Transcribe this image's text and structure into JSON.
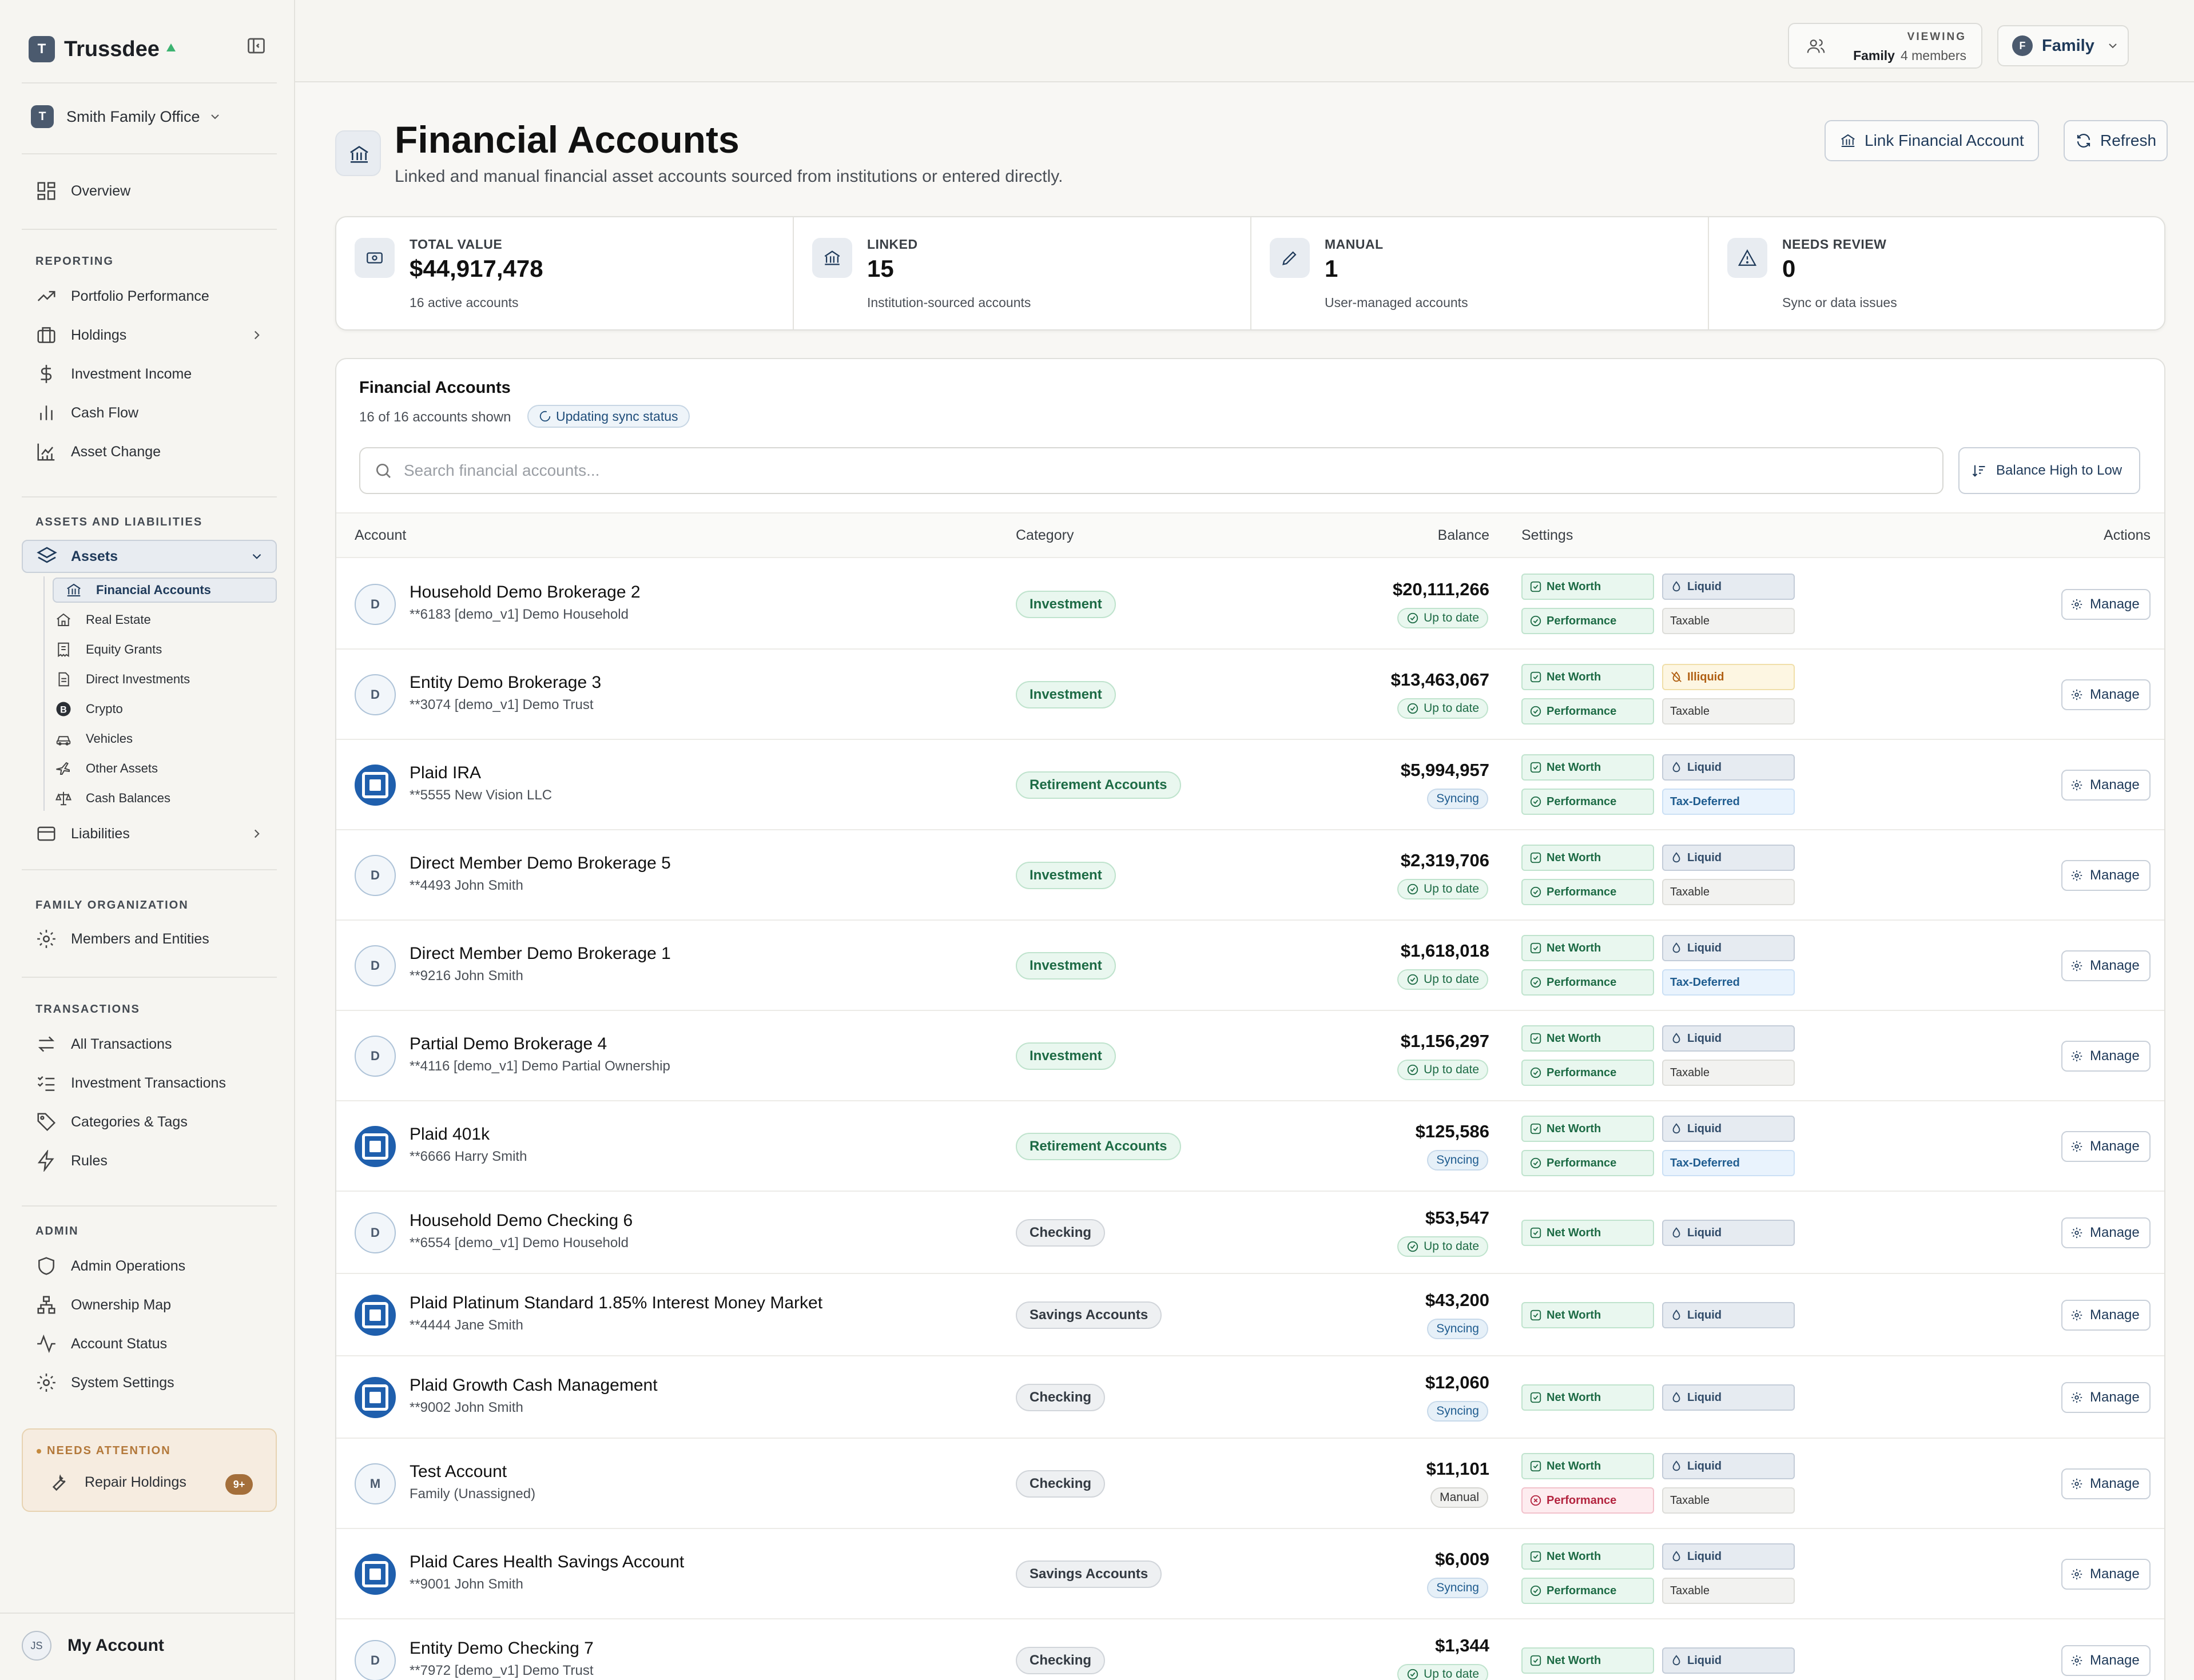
{
  "app": {
    "name": "Trussdee",
    "org": "Smith Family Office",
    "logo_letter": "T"
  },
  "sidebar": {
    "overview": "Overview",
    "reporting_header": "REPORTING",
    "reporting": [
      "Portfolio Performance",
      "Holdings",
      "Investment Income",
      "Cash Flow",
      "Asset Change"
    ],
    "assets_liab_header": "ASSETS AND LIABILITIES",
    "assets": "Assets",
    "asset_sub": [
      "Financial Accounts",
      "Real Estate",
      "Equity Grants",
      "Direct Investments",
      "Crypto",
      "Vehicles",
      "Other Assets",
      "Cash Balances"
    ],
    "liabilities": "Liabilities",
    "family_header": "FAMILY ORGANIZATION",
    "members": "Members and Entities",
    "transactions_header": "TRANSACTIONS",
    "transactions": [
      "All Transactions",
      "Investment Transactions",
      "Categories & Tags",
      "Rules"
    ],
    "admin_header": "ADMIN",
    "admin": [
      "Admin Operations",
      "Ownership Map",
      "Account Status",
      "System Settings"
    ],
    "attention_header": "NEEDS ATTENTION",
    "attention_item": "Repair Holdings",
    "attention_badge": "9+",
    "account_label": "My Account",
    "account_initials": "JS"
  },
  "topbar": {
    "viewing_label": "VIEWING",
    "viewing_name": "Family",
    "viewing_members": "4 members",
    "selector_letter": "F",
    "selector_label": "Family"
  },
  "page": {
    "title": "Financial Accounts",
    "subtitle": "Linked and manual financial asset accounts sourced from institutions or entered directly.",
    "link_button": "Link Financial Account",
    "refresh_button": "Refresh"
  },
  "stats": [
    {
      "label": "TOTAL VALUE",
      "value": "$44,917,478",
      "desc": "16 active accounts"
    },
    {
      "label": "LINKED",
      "value": "15",
      "desc": "Institution-sourced accounts"
    },
    {
      "label": "MANUAL",
      "value": "1",
      "desc": "User-managed accounts"
    },
    {
      "label": "NEEDS REVIEW",
      "value": "0",
      "desc": "Sync or data issues"
    }
  ],
  "table": {
    "title": "Financial Accounts",
    "count": "16 of 16 accounts shown",
    "sync_status": "Updating sync status",
    "search_placeholder": "Search financial accounts...",
    "sort_label": "Balance High to Low",
    "headers": {
      "account": "Account",
      "category": "Category",
      "balance": "Balance",
      "settings": "Settings",
      "actions": "Actions"
    },
    "manage_label": "Manage",
    "rows": [
      {
        "avatar": "D",
        "name": "Household Demo Brokerage 2",
        "sub": "**6183  [demo_v1] Demo Household",
        "category": "Investment",
        "balance": "$20,111,266",
        "status": "Up to date",
        "liquidity": "Liquid",
        "tax": "Taxable",
        "performance": "Performance"
      },
      {
        "avatar": "D",
        "name": "Entity Demo Brokerage 3",
        "sub": "**3074  [demo_v1] Demo Trust",
        "category": "Investment",
        "balance": "$13,463,067",
        "status": "Up to date",
        "liquidity": "Illiquid",
        "tax": "Taxable",
        "performance": "Performance"
      },
      {
        "avatar": "plaid",
        "name": "Plaid IRA",
        "sub": "**5555  New Vision LLC",
        "category": "Retirement Accounts",
        "balance": "$5,994,957",
        "status": "Syncing",
        "liquidity": "Liquid",
        "tax": "Tax-Deferred",
        "performance": "Performance"
      },
      {
        "avatar": "D",
        "name": "Direct Member Demo Brokerage 5",
        "sub": "**4493  John Smith",
        "category": "Investment",
        "balance": "$2,319,706",
        "status": "Up to date",
        "liquidity": "Liquid",
        "tax": "Taxable",
        "performance": "Performance"
      },
      {
        "avatar": "D",
        "name": "Direct Member Demo Brokerage 1",
        "sub": "**9216  John Smith",
        "category": "Investment",
        "balance": "$1,618,018",
        "status": "Up to date",
        "liquidity": "Liquid",
        "tax": "Tax-Deferred",
        "performance": "Performance"
      },
      {
        "avatar": "D",
        "name": "Partial Demo Brokerage 4",
        "sub": "**4116  [demo_v1] Demo Partial Ownership",
        "category": "Investment",
        "balance": "$1,156,297",
        "status": "Up to date",
        "liquidity": "Liquid",
        "tax": "Taxable",
        "performance": "Performance"
      },
      {
        "avatar": "plaid",
        "name": "Plaid 401k",
        "sub": "**6666  Harry Smith",
        "category": "Retirement Accounts",
        "balance": "$125,586",
        "status": "Syncing",
        "liquidity": "Liquid",
        "tax": "Tax-Deferred",
        "performance": "Performance"
      },
      {
        "avatar": "D",
        "name": "Household Demo Checking 6",
        "sub": "**6554  [demo_v1] Demo Household",
        "category": "Checking",
        "balance": "$53,547",
        "status": "Up to date",
        "liquidity": "Liquid",
        "tax": "",
        "performance": ""
      },
      {
        "avatar": "plaid",
        "name": "Plaid Platinum Standard 1.85% Interest Money Market",
        "sub": "**4444  Jane Smith",
        "category": "Savings Accounts",
        "balance": "$43,200",
        "status": "Syncing",
        "liquidity": "Liquid",
        "tax": "",
        "performance": ""
      },
      {
        "avatar": "plaid",
        "name": "Plaid Growth Cash Management",
        "sub": "**9002  John Smith",
        "category": "Checking",
        "balance": "$12,060",
        "status": "Syncing",
        "liquidity": "Liquid",
        "tax": "",
        "performance": ""
      },
      {
        "avatar": "M",
        "name": "Test Account",
        "sub": "Family (Unassigned)",
        "category": "Checking",
        "balance": "$11,101",
        "status": "Manual",
        "liquidity": "Liquid",
        "tax": "Taxable",
        "performance": "Performance"
      },
      {
        "avatar": "plaid",
        "name": "Plaid Cares Health Savings Account",
        "sub": "**9001  John Smith",
        "category": "Savings Accounts",
        "balance": "$6,009",
        "status": "Syncing",
        "liquidity": "Liquid",
        "tax": "Taxable",
        "performance": "Performance"
      },
      {
        "avatar": "D",
        "name": "Entity Demo Checking 7",
        "sub": "**7972  [demo_v1] Demo Trust",
        "category": "Checking",
        "balance": "$1,344",
        "status": "Up to date",
        "liquidity": "Liquid",
        "tax": "",
        "performance": ""
      }
    ],
    "net_worth_label": "Net Worth"
  }
}
